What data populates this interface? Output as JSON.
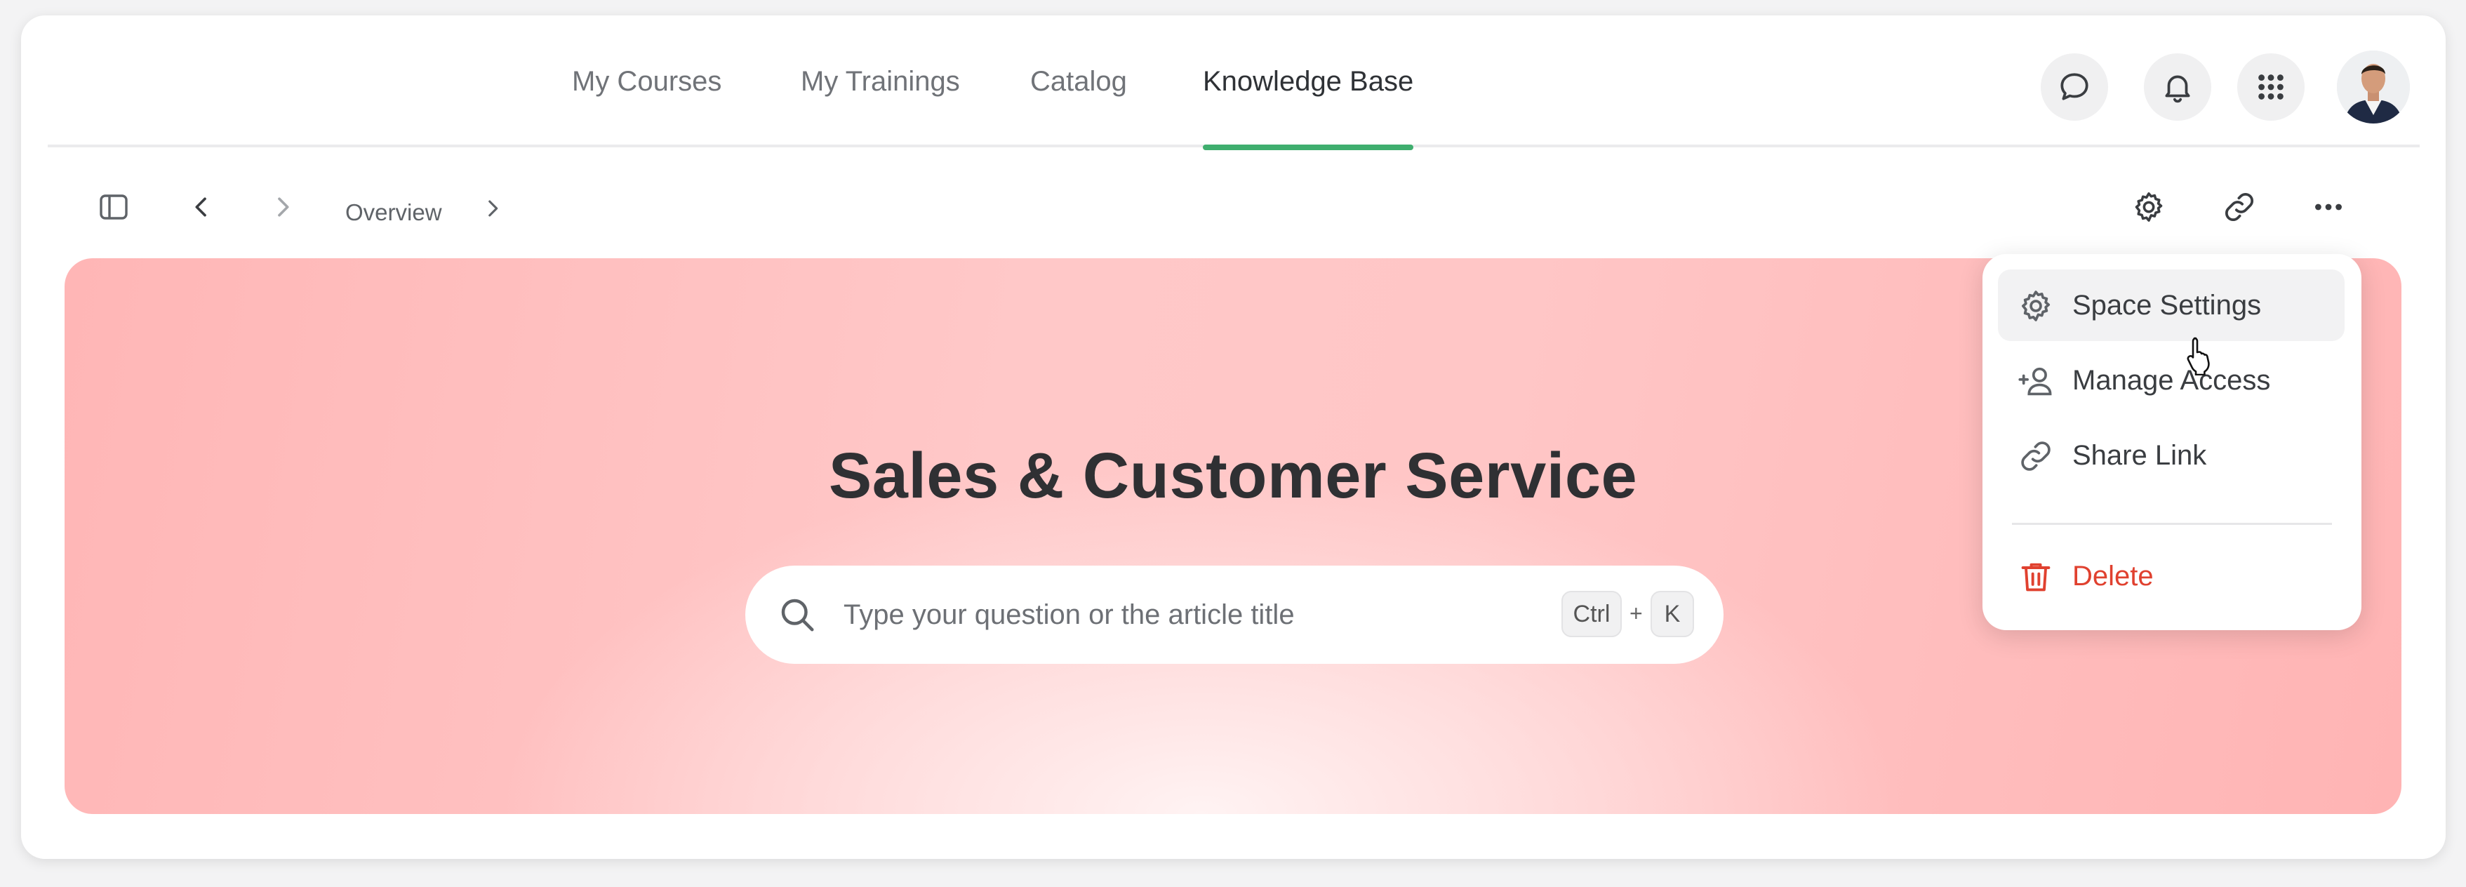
{
  "nav": {
    "tabs": [
      {
        "label": "My Courses"
      },
      {
        "label": "My Trainings"
      },
      {
        "label": "Catalog"
      },
      {
        "label": "Knowledge Base",
        "active": true
      }
    ],
    "icons": [
      "chat-icon",
      "bell-icon",
      "apps-grid-icon"
    ],
    "accent_color": "#3fae6e"
  },
  "toolbar": {
    "breadcrumb": "Overview",
    "icons": [
      "sidebar-toggle-icon",
      "back-icon",
      "forward-icon",
      "gear-icon",
      "link-icon",
      "more-icon"
    ]
  },
  "hero": {
    "title": "Sales & Customer Service",
    "search_placeholder": "Type your question or the article title",
    "shortcut_ctrl": "Ctrl",
    "shortcut_plus": "+",
    "shortcut_key": "K"
  },
  "menu": {
    "items": [
      {
        "label": "Space Settings",
        "icon": "gear-icon",
        "hover": true
      },
      {
        "label": "Manage Access",
        "icon": "add-user-icon"
      },
      {
        "label": "Share Link",
        "icon": "link-icon"
      },
      {
        "label": "Delete",
        "icon": "trash-icon",
        "danger": true,
        "color": "#e0412f"
      }
    ]
  }
}
